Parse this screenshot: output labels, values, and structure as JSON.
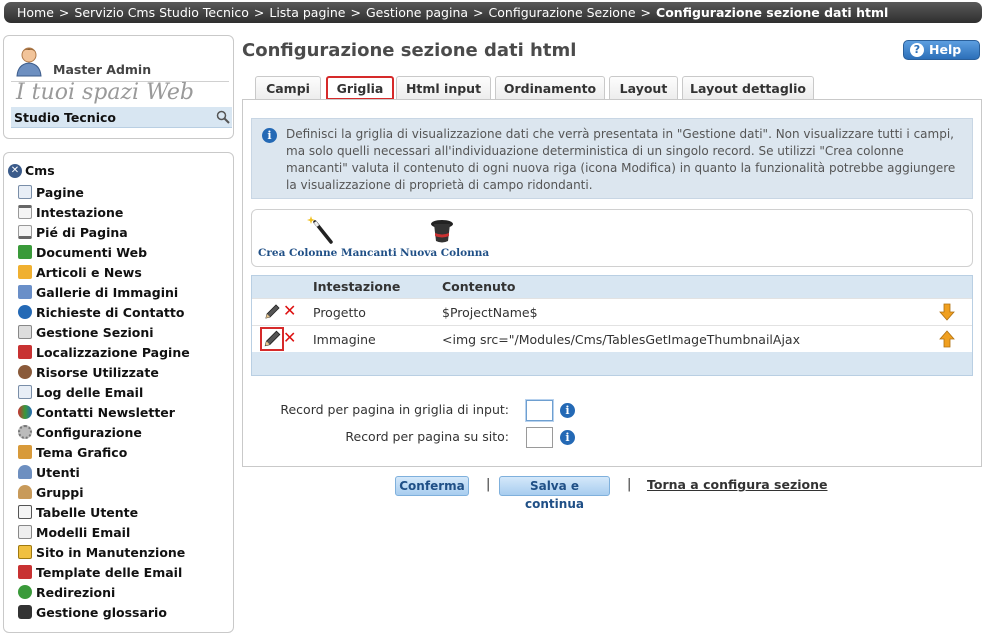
{
  "breadcrumb": {
    "items": [
      "Home",
      "Servizio Cms Studio Tecnico",
      "Lista pagine",
      "Gestione pagina",
      "Configurazione Sezione"
    ],
    "current": "Configurazione sezione dati html",
    "separator": ">"
  },
  "user": {
    "name": "Master Admin",
    "spaces_title": "I tuoi spazi Web",
    "current_space": "Studio Tecnico"
  },
  "menu": {
    "root": "Cms",
    "items": [
      {
        "label": "Pagine",
        "icon": "page-icon"
      },
      {
        "label": "Intestazione",
        "icon": "header-icon"
      },
      {
        "label": "Pié di Pagina",
        "icon": "footer-icon"
      },
      {
        "label": "Documenti Web",
        "icon": "web-documents-icon"
      },
      {
        "label": "Articoli e News",
        "icon": "news-icon"
      },
      {
        "label": "Gallerie di Immagini",
        "icon": "image-gallery-icon"
      },
      {
        "label": "Richieste di Contatto",
        "icon": "contact-request-icon"
      },
      {
        "label": "Gestione Sezioni",
        "icon": "sections-icon"
      },
      {
        "label": "Localizzazione Pagine",
        "icon": "localization-icon"
      },
      {
        "label": "Risorse Utilizzate",
        "icon": "resources-icon"
      },
      {
        "label": "Log delle Email",
        "icon": "email-log-icon"
      },
      {
        "label": "Contatti Newsletter",
        "icon": "newsletter-icon"
      },
      {
        "label": "Configurazione",
        "icon": "gear-icon"
      },
      {
        "label": "Tema Grafico",
        "icon": "theme-icon"
      },
      {
        "label": "Utenti",
        "icon": "user-icon"
      },
      {
        "label": "Gruppi",
        "icon": "group-icon"
      },
      {
        "label": "Tabelle Utente",
        "icon": "table-icon"
      },
      {
        "label": "Modelli Email",
        "icon": "email-template-icon"
      },
      {
        "label": "Sito in Manutenzione",
        "icon": "maintenance-icon"
      },
      {
        "label": "Template delle Email",
        "icon": "email-icon"
      },
      {
        "label": "Redirezioni",
        "icon": "redirect-icon"
      },
      {
        "label": "Gestione glossario",
        "icon": "glossary-icon"
      }
    ]
  },
  "page": {
    "title": "Configurazione sezione dati html",
    "help_label": "Help"
  },
  "tabs": [
    {
      "label": "Campi",
      "active": false
    },
    {
      "label": "Griglia",
      "active": true
    },
    {
      "label": "Html input",
      "active": false
    },
    {
      "label": "Ordinamento",
      "active": false
    },
    {
      "label": "Layout",
      "active": false
    },
    {
      "label": "Layout dettaglio",
      "active": false
    }
  ],
  "info": {
    "text": "Definisci la griglia di visualizzazione dati che verrà presentata in \"Gestione dati\". Non visualizzare tutti i campi, ma solo quelli necessari all'individuazione deterministica di un singolo record. Se utilizzi \"Crea colonne mancanti\" valuta il contenuto di ogni nuova riga (icona Modifica) in quanto la funzionalità potrebbe aggiungere la visualizzazione di proprietà di campo ridondanti."
  },
  "tools": {
    "create_missing": "Crea Colonne Mancanti",
    "new_column": "Nuova Colonna"
  },
  "grid": {
    "headers": {
      "intestazione": "Intestazione",
      "contenuto": "Contenuto"
    },
    "rows": [
      {
        "intestazione": "Progetto",
        "contenuto": "$ProjectName$",
        "arrow": "down"
      },
      {
        "intestazione": "Immagine",
        "contenuto": "<img src=\"/Modules/Cms/TablesGetImageThumbnailAjax",
        "arrow": "up"
      }
    ]
  },
  "records": {
    "input_label": "Record per pagina in griglia di input:",
    "input_value": "",
    "site_label": "Record per pagina su sito:",
    "site_value": ""
  },
  "actions": {
    "confirm": "Conferma",
    "save_continue": "Salva e continua",
    "separator": "|",
    "back": "Torna a configura sezione"
  },
  "colors": {
    "accent_blue": "#2469b5",
    "selected_outline": "#d62a2a",
    "grid_header": "#d8e6f2"
  }
}
